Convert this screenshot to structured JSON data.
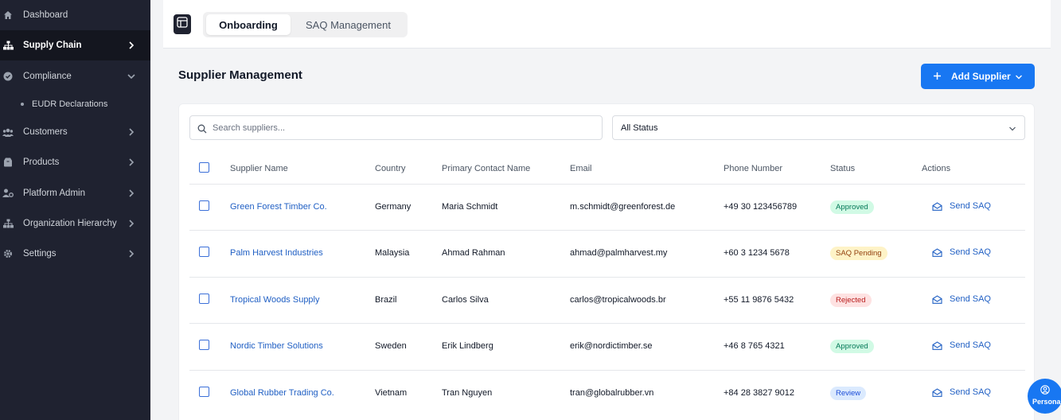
{
  "sidebar": {
    "items": [
      {
        "label": "Dashboard",
        "icon": "home-icon"
      },
      {
        "label": "Supply Chain",
        "icon": "sitemap-icon",
        "active": true
      },
      {
        "label": "Compliance",
        "icon": "check-circle-icon",
        "expanded": true
      },
      {
        "label": "EUDR Declarations"
      },
      {
        "label": "Customers",
        "icon": "users-icon"
      },
      {
        "label": "Products",
        "icon": "box-icon"
      },
      {
        "label": "Platform Admin",
        "icon": "user-cog-icon"
      },
      {
        "label": "Organization Hierarchy",
        "icon": "hierarchy-icon"
      },
      {
        "label": "Settings",
        "icon": "gear-icon"
      }
    ]
  },
  "topbar": {
    "tabs": [
      {
        "label": "Onboarding",
        "active": true
      },
      {
        "label": "SAQ Management",
        "active": false
      }
    ]
  },
  "main": {
    "title": "Supplier Management",
    "add_button": "Add Supplier",
    "search_placeholder": "Search suppliers...",
    "status_filter": "All Status",
    "columns": [
      "Supplier Name",
      "Country",
      "Primary Contact Name",
      "Email",
      "Phone Number",
      "Status",
      "Actions"
    ],
    "rows": [
      {
        "name": "Green Forest Timber Co.",
        "country": "Germany",
        "contact": "Maria Schmidt",
        "email": "m.schmidt@greenforest.de",
        "phone": "+49 30 123456789",
        "status": "Approved",
        "action": "Send SAQ"
      },
      {
        "name": "Palm Harvest Industries",
        "country": "Malaysia",
        "contact": "Ahmad Rahman",
        "email": "ahmad@palmharvest.my",
        "phone": "+60 3 1234 5678",
        "status": "SAQ Pending",
        "action": "Send SAQ"
      },
      {
        "name": "Tropical Woods Supply",
        "country": "Brazil",
        "contact": "Carlos Silva",
        "email": "carlos@tropicalwoods.br",
        "phone": "+55 11 9876 5432",
        "status": "Rejected",
        "action": "Send SAQ"
      },
      {
        "name": "Nordic Timber Solutions",
        "country": "Sweden",
        "contact": "Erik Lindberg",
        "email": "erik@nordictimber.se",
        "phone": "+46 8 765 4321",
        "status": "Approved",
        "action": "Send SAQ"
      },
      {
        "name": "Global Rubber Trading Co.",
        "country": "Vietnam",
        "contact": "Tran Nguyen",
        "email": "tran@globalrubber.vn",
        "phone": "+84 28 3827 9012",
        "status": "Review",
        "action": "Send SAQ"
      }
    ]
  },
  "status_colors": {
    "Approved": {
      "bg": "#d1fae5",
      "fg": "#047857"
    },
    "SAQ Pending": {
      "bg": "#fef3c7",
      "fg": "#92400e"
    },
    "Rejected": {
      "bg": "#fee2e2",
      "fg": "#b91c1c"
    },
    "Review": {
      "bg": "#dbeafe",
      "fg": "#1d4ed8"
    }
  },
  "persona": {
    "label": "Persona",
    "icon": "user-circle-icon"
  },
  "accent": "#1877f2"
}
